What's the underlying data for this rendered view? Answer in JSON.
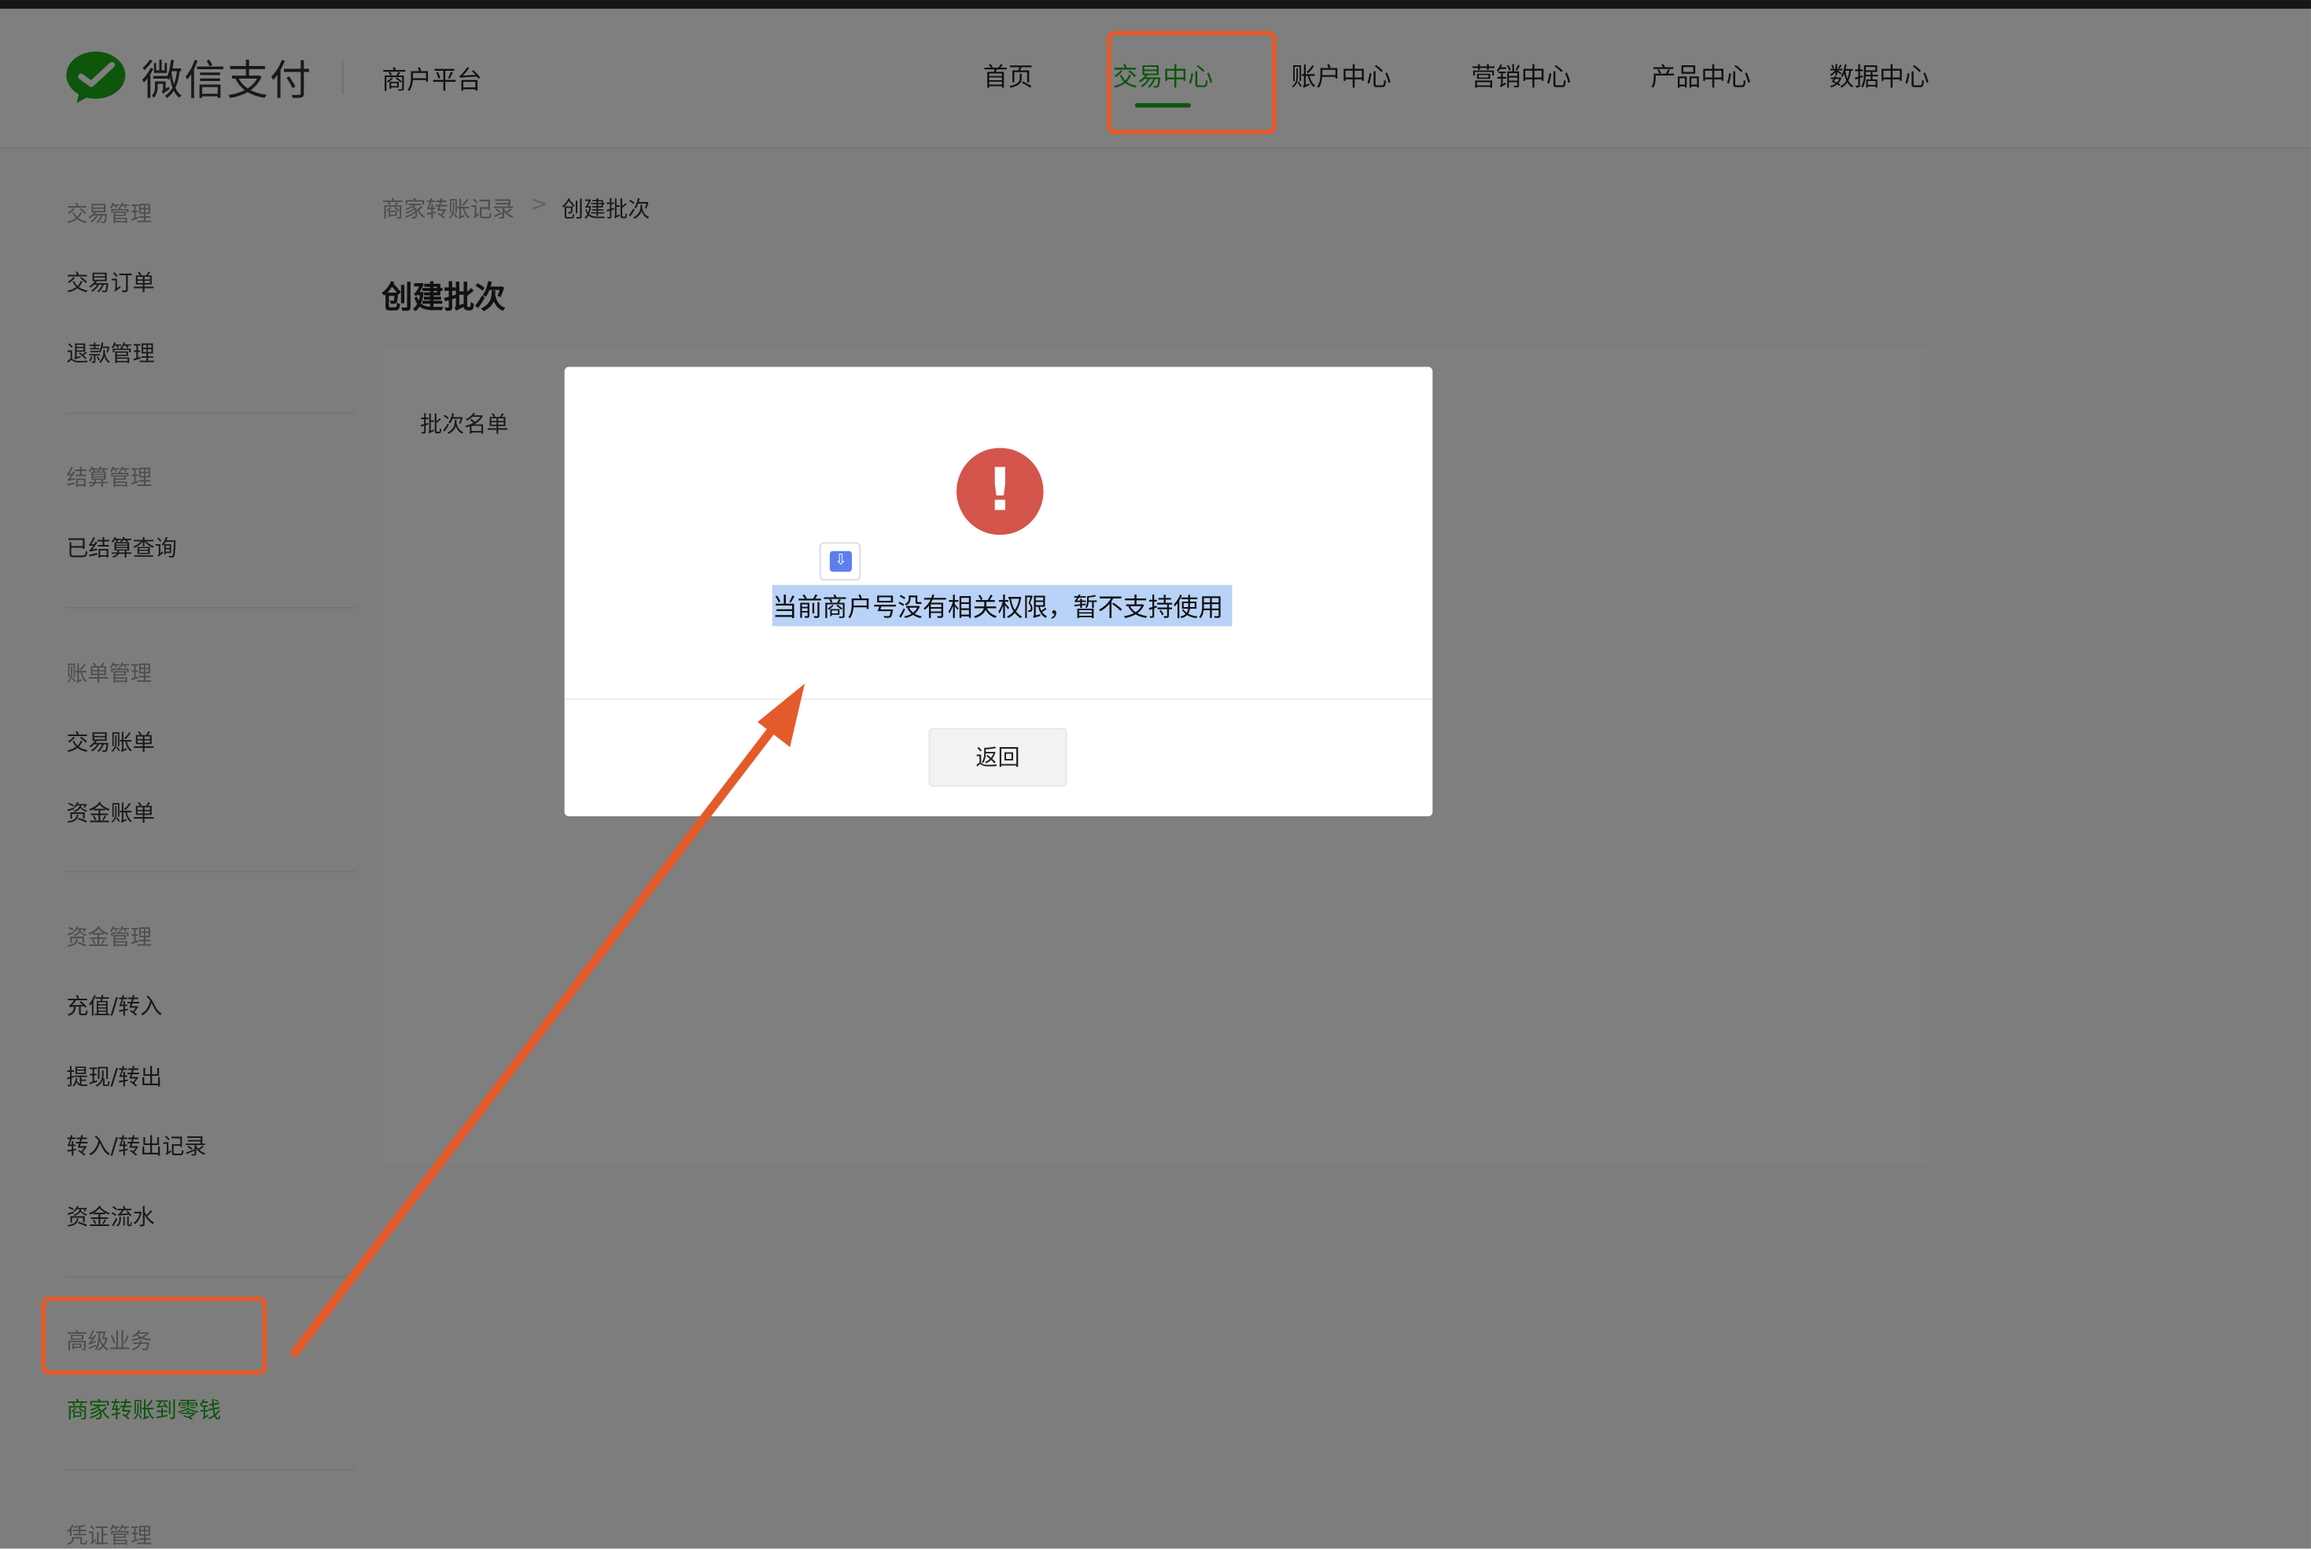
{
  "header": {
    "logo_text": "微信支付",
    "platform": "商户平台",
    "nav": [
      {
        "label": "首页"
      },
      {
        "label": "交易中心"
      },
      {
        "label": "账户中心"
      },
      {
        "label": "营销中心"
      },
      {
        "label": "产品中心"
      },
      {
        "label": "数据中心"
      }
    ],
    "active_nav": "交易中心"
  },
  "sidebar": {
    "groups": [
      {
        "title": "交易管理",
        "items": [
          "交易订单",
          "退款管理"
        ]
      },
      {
        "title": "结算管理",
        "items": [
          "已结算查询"
        ]
      },
      {
        "title": "账单管理",
        "items": [
          "交易账单",
          "资金账单"
        ]
      },
      {
        "title": "资金管理",
        "items": [
          "充值/转入",
          "提现/转出",
          "转入/转出记录",
          "资金流水"
        ]
      },
      {
        "title": "高级业务",
        "items": [
          "商家转账到零钱"
        ]
      },
      {
        "title": "凭证管理",
        "items": []
      }
    ],
    "active_item": "商家转账到零钱"
  },
  "main": {
    "breadcrumb": [
      "商家转账记录",
      "创建批次"
    ],
    "breadcrumb_sep": ">",
    "title": "创建批次",
    "field_label": "批次名单"
  },
  "modal": {
    "icon": "!",
    "message": "当前商户号没有相关权限，暂不支持使用",
    "button": "返回"
  },
  "colors": {
    "brand_green": "#1aad19",
    "annotation": "#e55a2a",
    "warning_red": "#d4544b"
  },
  "icons": {
    "logo": "wechat-pay-logo-icon",
    "warning": "exclamation-icon",
    "doc": "document-download-icon"
  }
}
